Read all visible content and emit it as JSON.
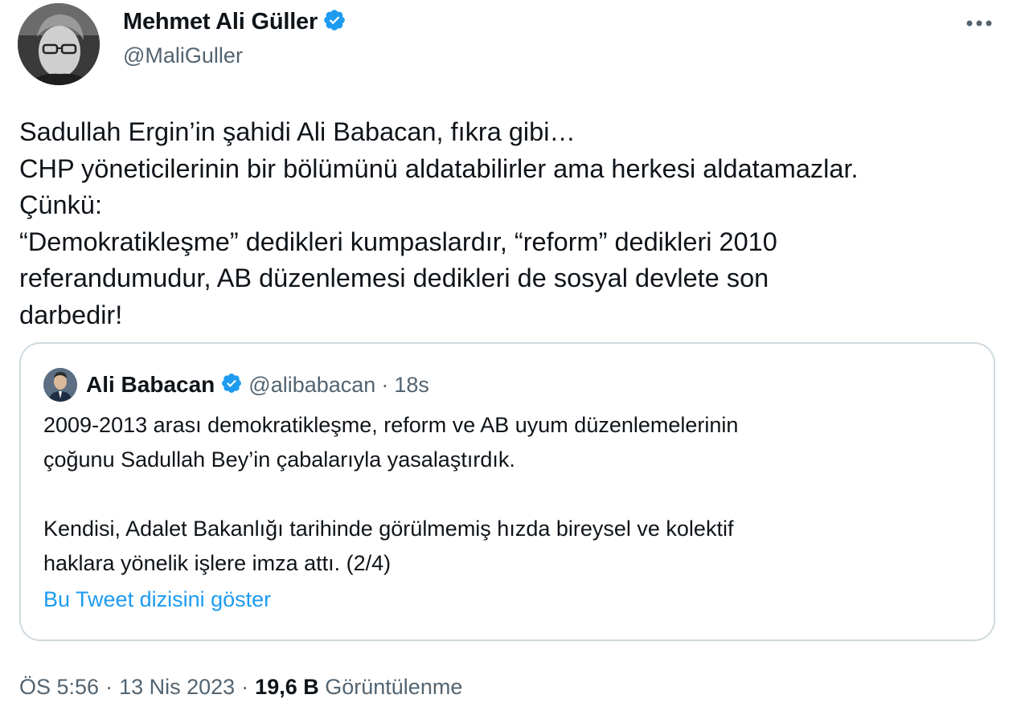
{
  "author": {
    "display_name": "Mehmet Ali Güller",
    "handle": "@MaliGuller",
    "verified_icon": "verified-badge-icon"
  },
  "more_icon": "more-options-icon",
  "tweet_text": [
    "Sadullah Ergin’in şahidi Ali Babacan, fıkra gibi…",
    "CHP yöneticilerinin bir bölümünü aldatabilirler ama herkesi aldatamazlar.",
    "Çünkü:",
    "“Demokratikleşme” dedikleri kumpaslardır, “reform” dedikleri 2010",
    "referandumudur, AB düzenlemesi dedikleri de sosyal devlete son",
    "darbedir!"
  ],
  "quoted_tweet": {
    "display_name": "Ali Babacan",
    "handle": "@alibabacan",
    "separator": "·",
    "time": "18s",
    "text": [
      "2009-2013 arası demokratikleşme, reform ve AB uyum düzenlemelerinin",
      "çoğunu Sadullah Bey’in çabalarıyla yasalaştırdık.",
      "",
      "Kendisi, Adalet Bakanlığı tarihinde görülmemiş hızda bireysel ve kolektif",
      "haklara yönelik işlere imza attı. (2/4)"
    ],
    "show_thread_link": "Bu Tweet dizisini göster"
  },
  "meta": {
    "time": "ÖS 5:56",
    "separator": "·",
    "date": "13 Nis 2023",
    "views_count": "19,6 B",
    "views_label": "Görüntülenme"
  },
  "colors": {
    "verified": "#1d9bf0",
    "link": "#1d9bf0",
    "secondary_text": "#536471",
    "border": "#cfd9de"
  }
}
